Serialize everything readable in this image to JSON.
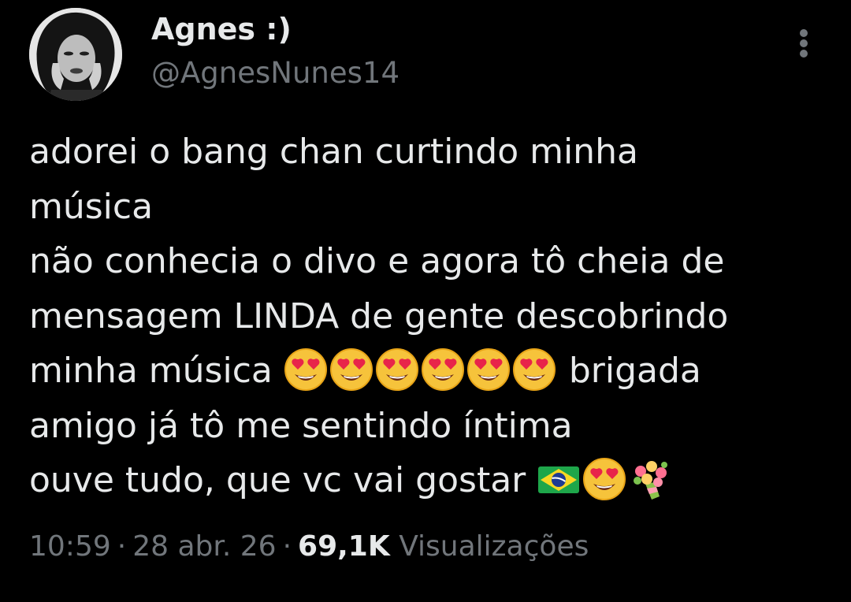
{
  "user": {
    "display_name": "Agnes :)",
    "handle": "@AgnesNunes14"
  },
  "tweet": {
    "line1": "adorei o bang chan curtindo minha",
    "line2": "música",
    "line3": "não conhecia o divo e agora tô cheia de",
    "line4": "mensagem LINDA de gente descobrindo",
    "line5_before": "minha música",
    "line5_after": "brigada",
    "line6": "amigo já tô me sentindo íntima",
    "line7": "ouve tudo, que vc vai gostar",
    "emojis_line5": [
      "heart-eyes",
      "heart-eyes",
      "heart-eyes",
      "heart-eyes",
      "heart-eyes",
      "heart-eyes"
    ],
    "emojis_line7": [
      "brazil-flag",
      "heart-eyes",
      "bouquet"
    ]
  },
  "meta": {
    "time": "10:59",
    "date": "28 abr. 26",
    "views_count": "69,1K",
    "views_label": "Visualizações",
    "separator": "·"
  },
  "colors": {
    "background": "#000000",
    "primary_text": "#e7e9ea",
    "secondary_text": "#71767b"
  }
}
